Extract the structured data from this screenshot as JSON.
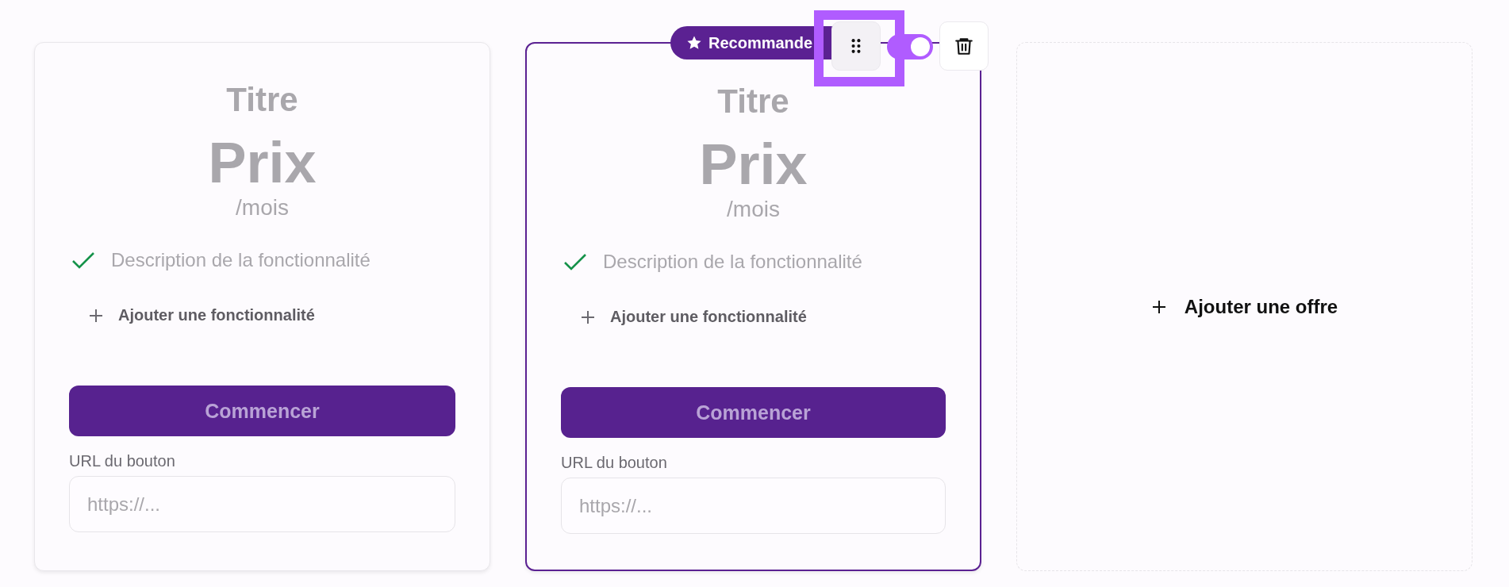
{
  "offers": [
    {
      "title": "Titre",
      "price": "Prix",
      "period": "/mois",
      "recommended": false,
      "features": [
        {
          "text": "Description de la fonctionnalité"
        }
      ],
      "add_feature_label": "Ajouter une fonctionnalité",
      "button_label": "Commencer",
      "url_label": "URL du bouton",
      "url_placeholder": "https://..."
    },
    {
      "title": "Titre",
      "price": "Prix",
      "period": "/mois",
      "recommended": true,
      "badge": "Recommande",
      "toolbar": {
        "drag_focused": true,
        "toggle_on": true
      },
      "features": [
        {
          "text": "Description de la fonctionnalité"
        }
      ],
      "add_feature_label": "Ajouter une fonctionnalité",
      "button_label": "Commencer",
      "url_label": "URL du bouton",
      "url_placeholder": "https://..."
    }
  ],
  "add_offer_label": "Ajouter une offre"
}
